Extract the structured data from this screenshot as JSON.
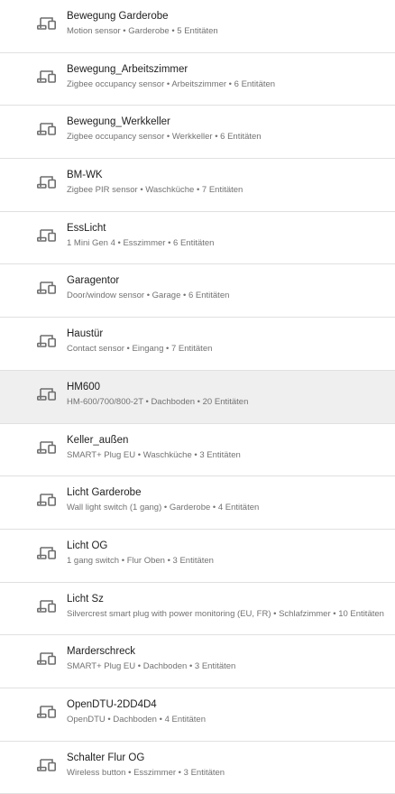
{
  "devices": [
    {
      "title": "Bewegung Garderobe",
      "subtitle": "Motion sensor • Garderobe • 5 Entitäten"
    },
    {
      "title": "Bewegung_Arbeitszimmer",
      "subtitle": "Zigbee occupancy sensor • Arbeitszimmer • 6 Entitäten"
    },
    {
      "title": "Bewegung_Werkkeller",
      "subtitle": "Zigbee occupancy sensor • Werkkeller • 6 Entitäten"
    },
    {
      "title": "BM-WK",
      "subtitle": "Zigbee PIR sensor • Waschküche • 7 Entitäten"
    },
    {
      "title": "EssLicht",
      "subtitle": "1 Mini Gen 4 • Esszimmer • 6 Entitäten"
    },
    {
      "title": "Garagentor",
      "subtitle": "Door/window sensor • Garage • 6 Entitäten"
    },
    {
      "title": "Haustür",
      "subtitle": "Contact sensor • Eingang • 7 Entitäten"
    },
    {
      "title": "HM600",
      "subtitle": "HM-600/700/800-2T • Dachboden • 20 Entitäten"
    },
    {
      "title": "Keller_außen",
      "subtitle": "SMART+ Plug EU • Waschküche • 3 Entitäten"
    },
    {
      "title": "Licht Garderobe",
      "subtitle": "Wall light switch (1 gang) • Garderobe • 4 Entitäten"
    },
    {
      "title": "Licht OG",
      "subtitle": "1 gang switch • Flur Oben • 3 Entitäten"
    },
    {
      "title": "Licht Sz",
      "subtitle": "Silvercrest smart plug with power monitoring (EU, FR) • Schlafzimmer • 10 Entitäten"
    },
    {
      "title": "Marderschreck",
      "subtitle": "SMART+ Plug EU • Dachboden • 3 Entitäten"
    },
    {
      "title": "OpenDTU-2DD4D4",
      "subtitle": "OpenDTU • Dachboden • 4 Entitäten"
    },
    {
      "title": "Schalter Flur OG",
      "subtitle": "Wireless button • Esszimmer • 3 Entitäten"
    }
  ],
  "highlighted_index": 7,
  "icon": "devices-icon",
  "colors": {
    "title": "#212121",
    "subtitle": "#727272",
    "icon": "#6f6f6f",
    "divider": "#e0e0e0",
    "highlight": "#efefef"
  }
}
